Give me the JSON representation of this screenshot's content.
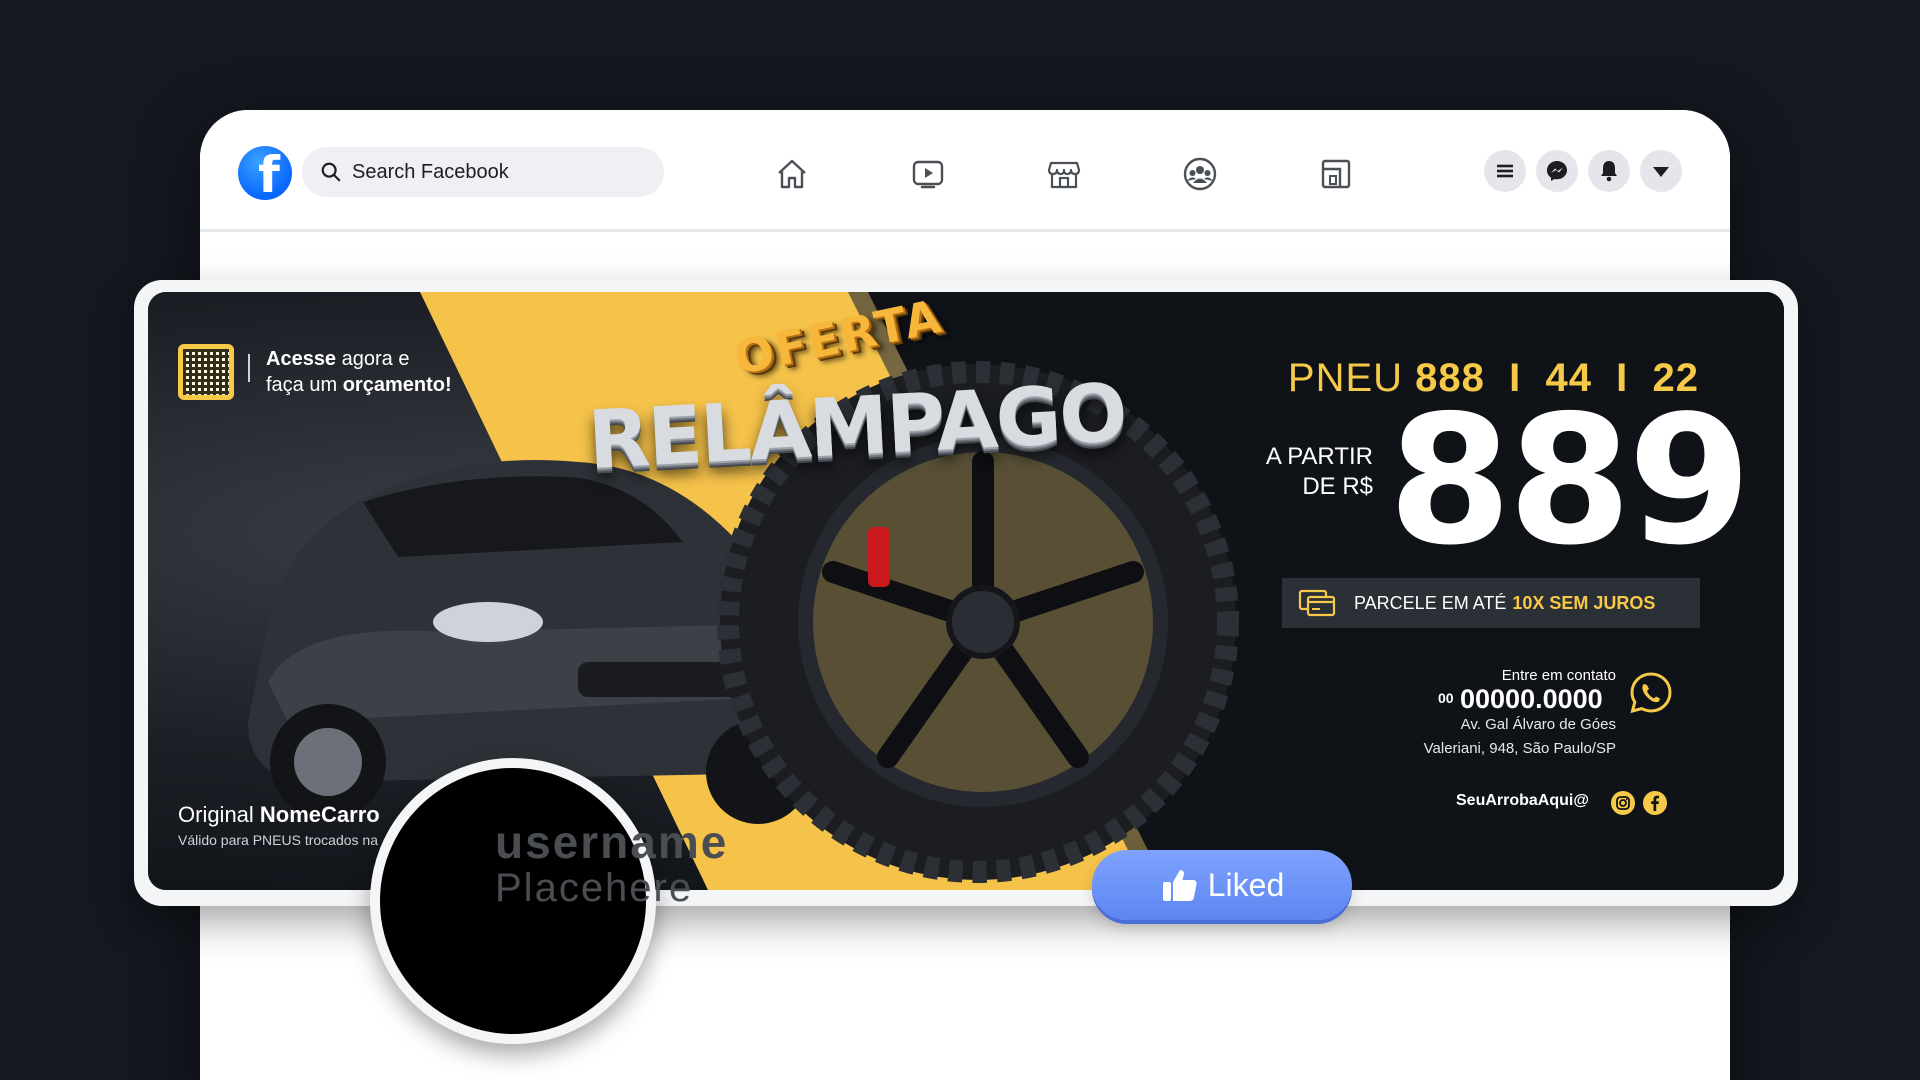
{
  "header": {
    "search_placeholder": "Search Facebook",
    "logo_letter": "f"
  },
  "colors": {
    "fb_blue": "#0866ff",
    "accent_yellow": "#f7c948",
    "banner_dark": "#0f1217",
    "liked_button": "#6a8ff5"
  },
  "nav_icons": [
    "home-icon",
    "video-icon",
    "marketplace-icon",
    "groups-icon",
    "gaming-icon"
  ],
  "right_icons": [
    "menu-icon",
    "messenger-icon",
    "notifications-icon",
    "account-dropdown-icon"
  ],
  "banner": {
    "qr_text_bold": "Acesse",
    "qr_text_1": " agora e",
    "qr_text_2": "faça um ",
    "qr_text_2_bold": "orçamento!",
    "oferta": "OFERTA",
    "relampago": "RELÂMPAGO",
    "car_label_prefix": "Original ",
    "car_label_bold": "NomeCarro",
    "car_note": "Válido para PNEUS trocados na",
    "pneu_prefix": "PNEU ",
    "pneu_spec": "888  I  44  I  22",
    "from_line1": "A PARTIR",
    "from_line2": "DE R$",
    "price": "889",
    "installment_text": "PARCELE EM ATÉ",
    "installment_highlight": "10X SEM JUROS",
    "contact_label": "Entre em contato",
    "phone_prefix": "00",
    "phone": "00000.0000",
    "address_line1": "Av. Gal Álvaro de Góes",
    "address_line2": "Valeriani, 948, São Paulo/SP",
    "handle": "SeuArrobaAqui@"
  },
  "profile": {
    "username": "username",
    "subtitle": "Placehere",
    "liked_label": "Liked"
  }
}
